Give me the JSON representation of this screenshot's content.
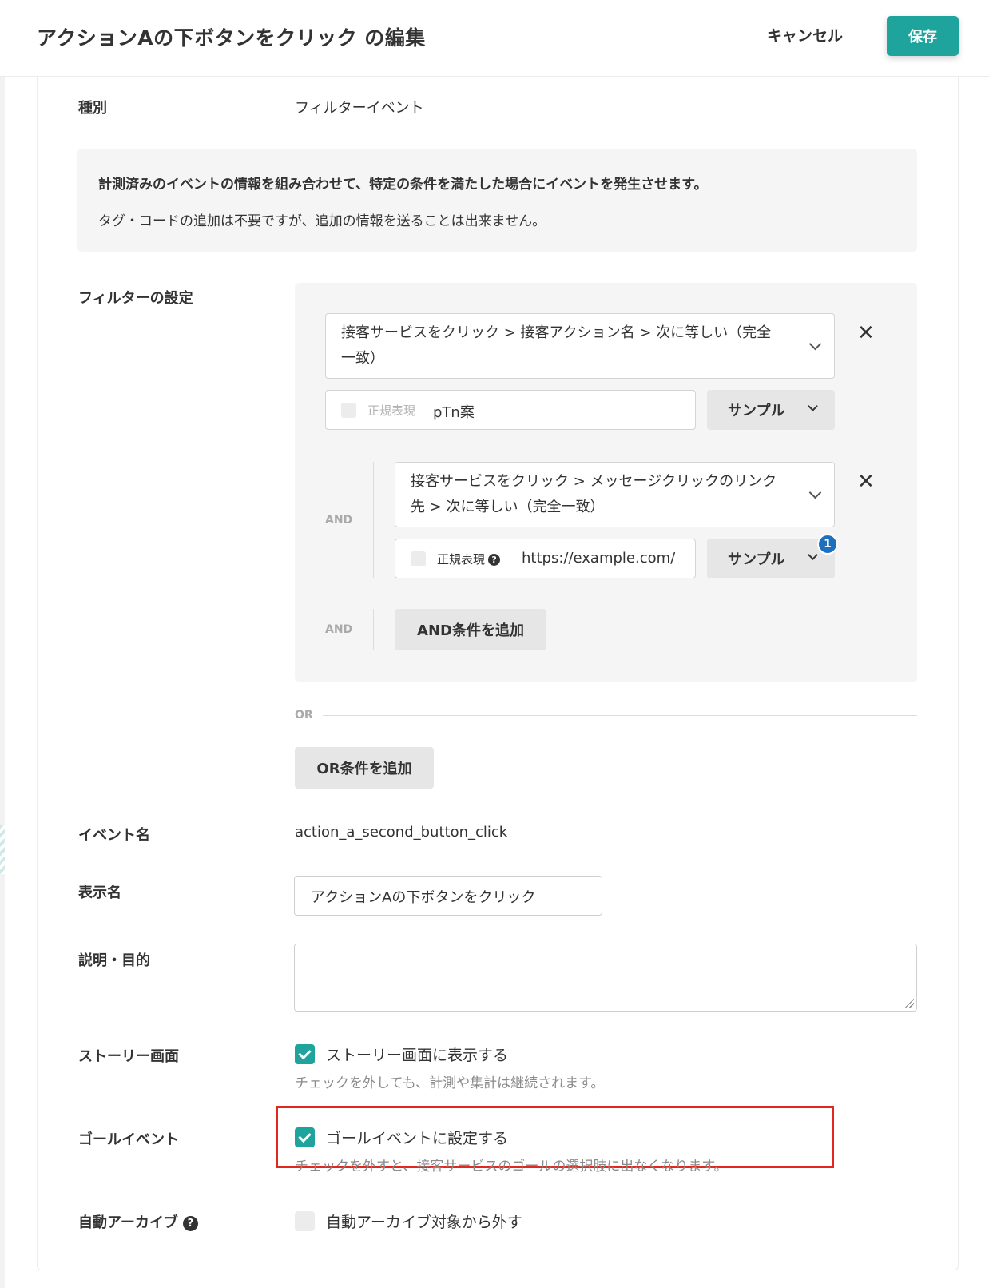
{
  "header": {
    "title": "アクションAの下ボタンをクリック の編集",
    "cancel_label": "キャンセル",
    "save_label": "保存"
  },
  "type_row": {
    "label": "種別",
    "value": "フィルターイベント"
  },
  "info": {
    "bold_text": "計測済みのイベントの情報を組み合わせて、特定の条件を満たした場合にイベントを発生させます。",
    "normal_text": "タグ・コードの追加は不要ですが、追加の情報を送ることは出来ません。"
  },
  "filter": {
    "label": "フィルターの設定",
    "conditions": [
      {
        "line1": "接客サービスをクリック > 接客アクション名 > 次に等しい（完全",
        "line2": "一致）",
        "regex_label": "正規表現",
        "value": "pTn案",
        "sample_label": "サンプル"
      },
      {
        "connector": "AND",
        "line1": "接客サービスをクリック > メッセージクリックのリンク",
        "line2": "先 > 次に等しい（完全一致）",
        "regex_label": "正規表現",
        "value": "https://example.com/",
        "sample_label": "サンプル",
        "badge": "1"
      }
    ],
    "add_and": {
      "connector": "AND",
      "label": "AND条件を追加"
    },
    "or_label": "OR",
    "add_or_label": "OR条件を追加"
  },
  "event_name": {
    "label": "イベント名",
    "value": "action_a_second_button_click"
  },
  "display_name": {
    "label": "表示名",
    "value": "アクションAの下ボタンをクリック"
  },
  "description": {
    "label": "説明・目的",
    "value": ""
  },
  "story": {
    "label": "ストーリー画面",
    "checkbox_label": "ストーリー画面に表示する",
    "checked": true,
    "hint": "チェックを外しても、計測や集計は継続されます。"
  },
  "goal": {
    "label": "ゴールイベント",
    "checkbox_label": "ゴールイベントに設定する",
    "checked": true,
    "hint": "チェックを外すと、接客サービスのゴールの選択肢に出なくなります。"
  },
  "auto_archive": {
    "label": "自動アーカイブ",
    "checkbox_label": "自動アーカイブ対象から外す",
    "checked": false
  },
  "colors": {
    "accent": "#1fa39d",
    "badge": "#1f6fbf",
    "highlight": "#e0281e"
  }
}
